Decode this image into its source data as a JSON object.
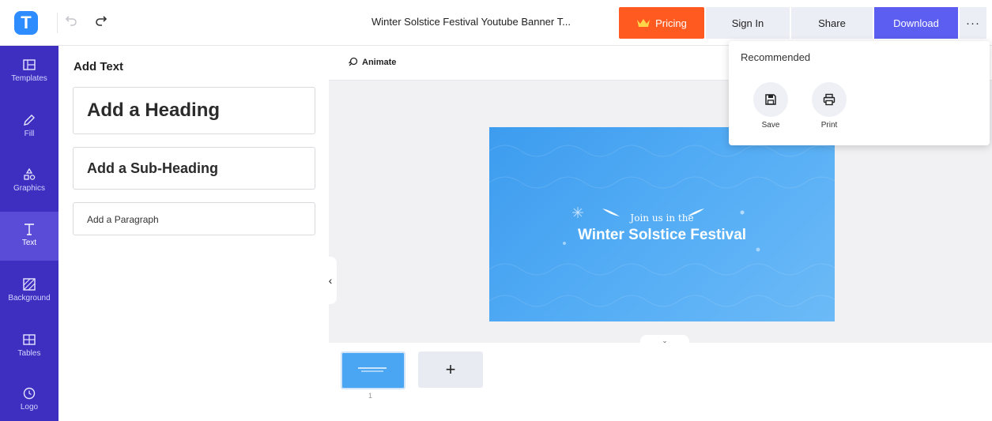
{
  "app": {
    "logo_letter": "T",
    "document_title": "Winter Solstice Festival Youtube Banner T..."
  },
  "header": {
    "undo_icon": "undo-icon",
    "redo_icon": "redo-icon",
    "pricing_label": "Pricing",
    "signin_label": "Sign In",
    "share_label": "Share",
    "download_label": "Download",
    "more_label": "···"
  },
  "sidebar": {
    "items": [
      {
        "label": "Templates",
        "icon": "templates-icon"
      },
      {
        "label": "Fill",
        "icon": "pencil-icon"
      },
      {
        "label": "Graphics",
        "icon": "shapes-icon"
      },
      {
        "label": "Text",
        "icon": "text-icon",
        "active": true
      },
      {
        "label": "Background",
        "icon": "background-icon"
      },
      {
        "label": "Tables",
        "icon": "table-icon"
      },
      {
        "label": "Logo",
        "icon": "logo-icon"
      }
    ]
  },
  "panel": {
    "title": "Add Text",
    "heading": "Add a Heading",
    "subheading": "Add a Sub-Heading",
    "paragraph": "Add a Paragraph"
  },
  "toolbar": {
    "animate_label": "Animate"
  },
  "banner": {
    "subtitle": "Join us in the",
    "title": "Winter Solstice Festival"
  },
  "pages": {
    "page_number": "1",
    "add_label": "+"
  },
  "dropdown": {
    "title": "Recommended",
    "items": [
      {
        "label": "Save",
        "icon": "save-icon"
      },
      {
        "label": "Print",
        "icon": "print-icon"
      }
    ]
  },
  "colors": {
    "brand": "#3e2fc0",
    "pricing": "#ff5a1f",
    "download": "#5b5ef0",
    "banner": "#4aa5f2"
  }
}
